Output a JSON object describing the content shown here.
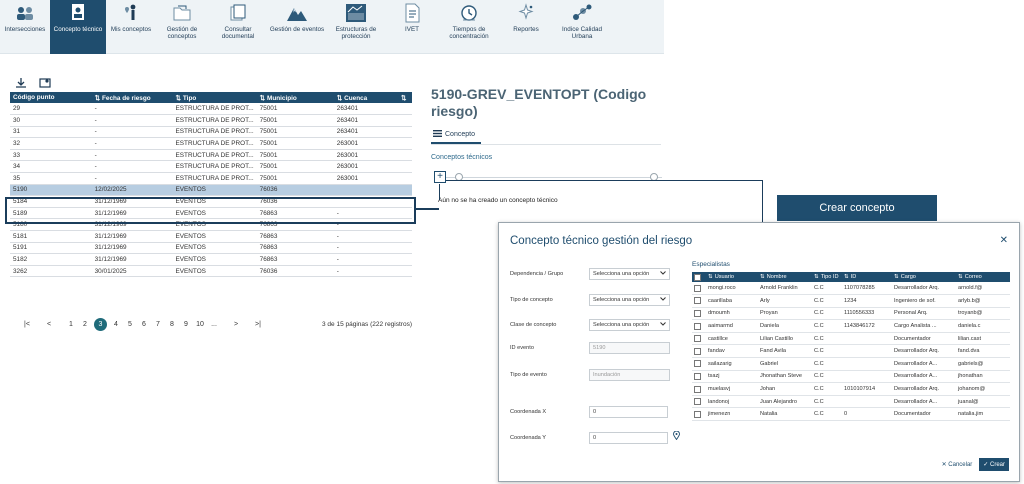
{
  "nav": [
    {
      "label": "Intersecciones",
      "icon": "group-icon",
      "active": false
    },
    {
      "label": "Concepto técnico",
      "icon": "document-person-icon",
      "active": true
    },
    {
      "label": "Mis conceptos",
      "icon": "person-pin-icon",
      "active": false
    },
    {
      "label": "Gestión de conceptos",
      "icon": "folder-icon",
      "active": false
    },
    {
      "label": "Consultar documental",
      "icon": "docs-icon",
      "active": false
    },
    {
      "label": "Gestión de eventos",
      "icon": "mountain-icon",
      "active": false
    },
    {
      "label": "Estructuras de protección",
      "icon": "structure-icon",
      "active": false
    },
    {
      "label": "IVET",
      "icon": "page-icon",
      "active": false
    },
    {
      "label": "Tiempos de concentración",
      "icon": "clock-icon",
      "active": false
    },
    {
      "label": "Reportes",
      "icon": "sparkle-icon",
      "active": false
    },
    {
      "label": "Indice Calidad Urbana",
      "icon": "network-icon",
      "active": false
    }
  ],
  "table": {
    "columns": [
      "Código punto",
      "Fecha de riesgo",
      "Tipo",
      "Municipio",
      "Cuenca"
    ],
    "rows": [
      [
        "29",
        "-",
        "ESTRUCTURA DE PROT...",
        "75001",
        "263401"
      ],
      [
        "30",
        "-",
        "ESTRUCTURA DE PROT...",
        "75001",
        "263401"
      ],
      [
        "31",
        "-",
        "ESTRUCTURA DE PROT...",
        "75001",
        "263401"
      ],
      [
        "32",
        "-",
        "ESTRUCTURA DE PROT...",
        "75001",
        "263001"
      ],
      [
        "33",
        "-",
        "ESTRUCTURA DE PROT...",
        "75001",
        "263001"
      ],
      [
        "34",
        "-",
        "ESTRUCTURA DE PROT...",
        "75001",
        "263001"
      ],
      [
        "35",
        "-",
        "ESTRUCTURA DE PROT...",
        "75001",
        "263001"
      ],
      [
        "5190",
        "12/02/2025",
        "EVENTOS",
        "76036",
        ""
      ],
      [
        "5184",
        "31/12/1969",
        "EVENTOS",
        "76036",
        ""
      ],
      [
        "5189",
        "31/12/1969",
        "EVENTOS",
        "76863",
        "-"
      ],
      [
        "5180",
        "31/12/1969",
        "EVENTOS",
        "76863",
        "-"
      ],
      [
        "5181",
        "31/12/1969",
        "EVENTOS",
        "76863",
        "-"
      ],
      [
        "5191",
        "31/12/1969",
        "EVENTOS",
        "76863",
        "-"
      ],
      [
        "5182",
        "31/12/1969",
        "EVENTOS",
        "76863",
        "-"
      ],
      [
        "3262",
        "30/01/2025",
        "EVENTOS",
        "76036",
        "-"
      ]
    ],
    "selected_index": 7
  },
  "pager": {
    "first": "|<",
    "prev": "<",
    "pages": [
      "1",
      "2",
      "3",
      "4",
      "5",
      "6",
      "7",
      "8",
      "9",
      "10",
      "..."
    ],
    "current": "3",
    "next": ">",
    "last": ">|",
    "info": "3 de 15 páginas (222 registros)"
  },
  "detail": {
    "title": "5190-GREV_EVENTOPT (Codigo riesgo)",
    "tab": "Concepto",
    "subtitle": "Conceptos técnicos",
    "plus": "+",
    "empty": "Aún no se ha creado un concepto técnico"
  },
  "callout": "Crear concepto",
  "modal": {
    "title": "Concepto técnico gestión del riesgo",
    "close": "✕",
    "fields": [
      {
        "label": "Dependencia / Grupo",
        "type": "select",
        "value": "Selecciona una opción"
      },
      {
        "label": "Tipo de concepto",
        "type": "select",
        "value": "Selecciona una opción"
      },
      {
        "label": "Clase de concepto",
        "type": "select",
        "value": "Selecciona una opción"
      },
      {
        "label": "ID evento",
        "type": "input",
        "value": "5190"
      },
      {
        "label": "Tipo de evento",
        "type": "input",
        "value": "Inundación"
      },
      {
        "label": "Coordenada X",
        "type": "input",
        "value": "0"
      },
      {
        "label": "Coordenada Y",
        "type": "input",
        "value": "0"
      }
    ],
    "specialists_title": "Especialistas",
    "spec_columns": [
      "Usuario",
      "Nombre",
      "Tipo ID",
      "ID",
      "Cargo",
      "Correo"
    ],
    "specialists": [
      [
        "mongi.roco",
        "Arnold Franklin",
        "C.C",
        "1107078285",
        "Desarrollador Arq.",
        "arnold.f@"
      ],
      [
        "caarillaba",
        "Arly",
        "C.C",
        "1234",
        "Ingeniero de sof.",
        "arlyb.b@"
      ],
      [
        "dmoumh",
        "Proyan",
        "C.C",
        "1110556333",
        "Personal Arq.",
        "troyanb@"
      ],
      [
        "aaimarmd",
        "Daniela",
        "C.C",
        "1143846172",
        "Cargo Analista ...",
        "daniela.c"
      ],
      [
        "castillce",
        "Lilian Castillo",
        "C.C",
        "",
        "Documentador",
        "lilian.cast"
      ],
      [
        "fandav",
        "Fand Avila",
        "C.C",
        "",
        "Desarrollador Arq.",
        "fand.dva"
      ],
      [
        "sailazarig",
        "Gabriel",
        "C.C",
        "",
        "Desarrollador A...",
        "gabriels@"
      ],
      [
        "tsazj",
        "Jhonathan Steve",
        "C.C",
        "",
        "Desarrollador A...",
        "jhonathan"
      ],
      [
        "muelasvj",
        "Johan",
        "C.C",
        "1010107914",
        "Desarrollador Arq.",
        "johanom@"
      ],
      [
        "landonoj",
        "Juan Alejandro",
        "C.C",
        "",
        "Desarrollador A...",
        "juanal@"
      ],
      [
        "jimenezn",
        "Natalia",
        "C.C",
        "0",
        "Documentador",
        "natalia.jim"
      ]
    ],
    "cancel_label": "✕ Cancelar",
    "create_label": "✓ Crear"
  },
  "colors": {
    "primary": "#1f4d6e",
    "accent": "#1f6b7a",
    "selected_row": "#b7cde1"
  }
}
